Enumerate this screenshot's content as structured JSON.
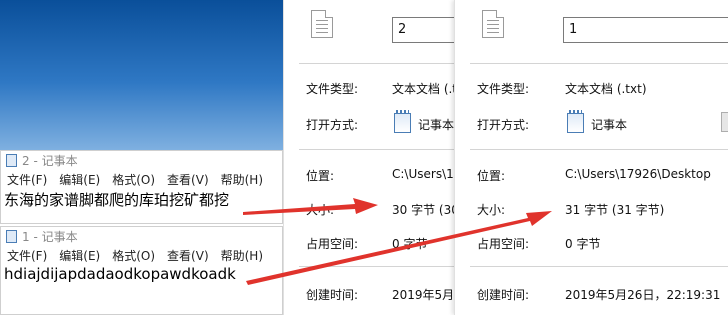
{
  "colors": {
    "arrow": "#e0332c",
    "wallpaper": "#2f78c4"
  },
  "notepad_window_2": {
    "title": "2 - 记事本",
    "menu": [
      "文件(F)",
      "编辑(E)",
      "格式(O)",
      "查看(V)",
      "帮助(H)"
    ],
    "content": "东海的家谱脚都爬的库珀挖矿都挖"
  },
  "notepad_window_1": {
    "title": "1 - 记事本",
    "menu": [
      "文件(F)",
      "编辑(E)",
      "格式(O)",
      "查看(V)",
      "帮助(H)"
    ],
    "content": "hdiajdijapdadaodkopawdkoadk"
  },
  "properties_2": {
    "filename": "2",
    "type_label": "文件类型:",
    "type_value": "文本文档 (.tx",
    "opens_label": "打开方式:",
    "opens_value": "记事本",
    "location_label": "位置:",
    "location_value": "C:\\Users\\1",
    "size_label": "大小:",
    "size_value": "30 字节 (30",
    "disk_label": "占用空间:",
    "disk_value": "0 字节",
    "created_label": "创建时间:",
    "created_value": "2019年5月2"
  },
  "properties_1": {
    "filename": "1",
    "type_label": "文件类型:",
    "type_value": "文本文档 (.txt)",
    "opens_label": "打开方式:",
    "opens_value": "记事本",
    "location_label": "位置:",
    "location_value": "C:\\Users\\17926\\Desktop",
    "size_label": "大小:",
    "size_value": "31 字节 (31 字节)",
    "disk_label": "占用空间:",
    "disk_value": "0 字节",
    "created_label": "创建时间:",
    "created_value": "2019年5月26日，22:19:31"
  }
}
